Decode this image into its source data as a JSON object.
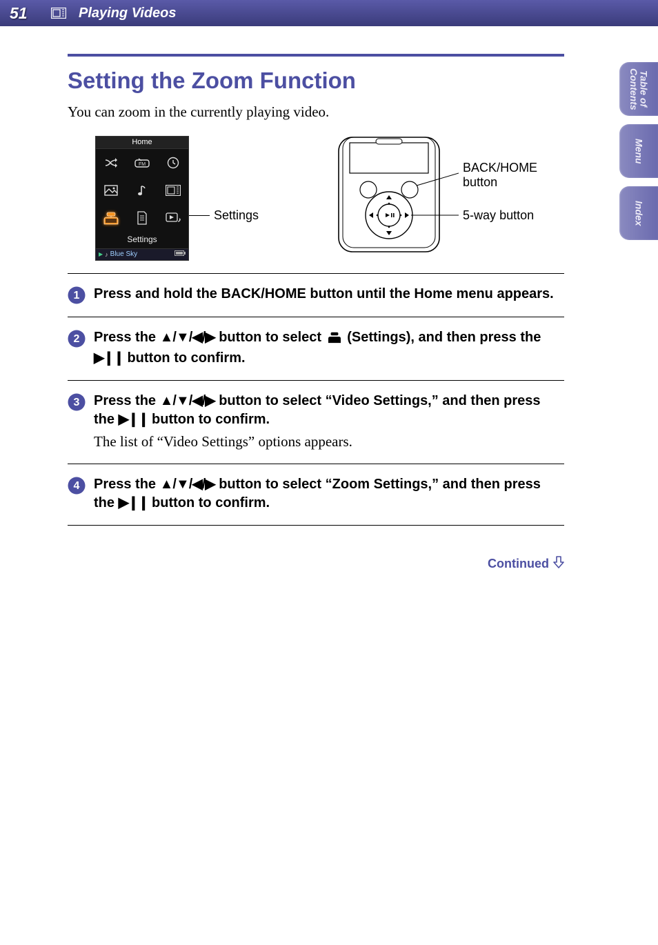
{
  "header": {
    "page_number": "51",
    "section": "Playing Videos"
  },
  "side_tabs": {
    "toc_line1": "Table of",
    "toc_line2": "Contents",
    "menu": "Menu",
    "index": "Index"
  },
  "title": "Setting the Zoom Function",
  "intro": "You can zoom in the currently playing video.",
  "figure": {
    "home_title": "Home",
    "home_label": "Settings",
    "now_playing_track": "Blue Sky",
    "callout_settings": "Settings",
    "callout_backhome_1": "BACK/HOME",
    "callout_backhome_2": "button",
    "callout_5way": "5-way button"
  },
  "steps": [
    {
      "pre": "Press and hold the BACK/HOME button until the Home menu appears.",
      "post": "",
      "note": ""
    },
    {
      "pre": "Press the ",
      "mid": " button to select ",
      "post": " (Settings), and then press the ",
      "tail": " button to confirm.",
      "note": ""
    },
    {
      "pre": "Press the ",
      "mid": " button to select “Video Settings,” and then press the ",
      "tail": " button to confirm.",
      "note": "The list of “Video Settings” options appears."
    },
    {
      "pre": "Press the ",
      "mid": " button to select “Zoom Settings,” and then press the ",
      "tail": " button to confirm.",
      "note": ""
    }
  ],
  "glyphs": {
    "arrows": "▲/▼/◀/▶",
    "playpause": "▶❙❙"
  },
  "continued": "Continued"
}
